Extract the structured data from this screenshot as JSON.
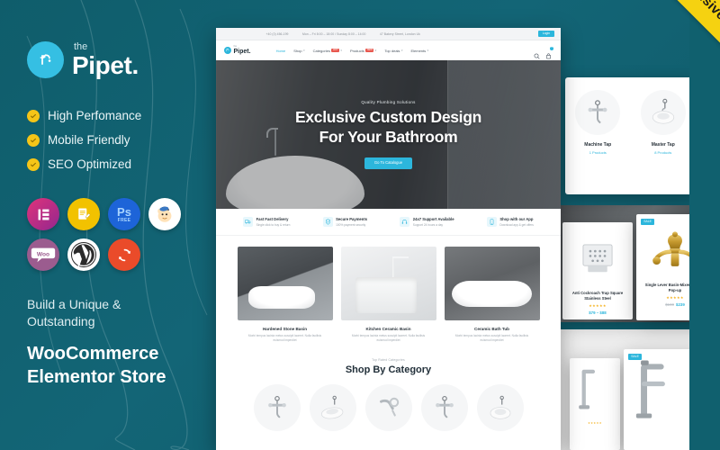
{
  "ribbon": {
    "label": "Responsive"
  },
  "promo": {
    "logo": {
      "the": "the",
      "name": "Pipet.",
      "icon": "faucet-icon"
    },
    "bullets": [
      {
        "label": "High Perfomance",
        "icon": "check-circle-icon"
      },
      {
        "label": "Mobile Friendly",
        "icon": "check-circle-icon"
      },
      {
        "label": "SEO Optimized",
        "icon": "check-circle-icon"
      }
    ],
    "badges": [
      {
        "name": "elementor-badge",
        "label": "Elementor"
      },
      {
        "name": "notes-badge",
        "label": "Documentation"
      },
      {
        "name": "photoshop-badge",
        "label": "Ps",
        "sub": "FREE"
      },
      {
        "name": "mailchimp-badge",
        "label": "Mailchimp"
      },
      {
        "name": "woocommerce-badge",
        "label": "Woo"
      },
      {
        "name": "wordpress-badge",
        "label": "WordPress"
      },
      {
        "name": "updates-badge",
        "label": "Free Updates"
      }
    ],
    "tagline_small": "Build a Unique &\nOutstanding",
    "tagline_big_1": "WooCommerce",
    "tagline_big_2": "Elementor Store"
  },
  "site": {
    "topbar": {
      "phone": "+40 (0) 456-199",
      "hours": "Mon – Fri 8:00 – 18:00 / Sunday 8:00 – 14:00",
      "address": "47 Bakery Street, London Uk",
      "login_label": "Login"
    },
    "nav": {
      "brand_the": "the",
      "brand_name": "Pipet.",
      "links": [
        {
          "label": "Home",
          "active": true,
          "caret": false,
          "pill": ""
        },
        {
          "label": "Shop",
          "active": false,
          "caret": true,
          "pill": ""
        },
        {
          "label": "Categories",
          "active": false,
          "caret": true,
          "pill": "HOT"
        },
        {
          "label": "Products",
          "active": false,
          "caret": true,
          "pill": "NEW"
        },
        {
          "label": "Top deals",
          "active": false,
          "caret": true,
          "pill": ""
        },
        {
          "label": "Elements",
          "active": false,
          "caret": true,
          "pill": ""
        }
      ],
      "search_icon": "search-icon",
      "cart_icon": "cart-icon",
      "cart_count": "0"
    },
    "hero": {
      "kicker": "Quality Plumbing Solutions",
      "title_line1": "Exclusive Custom Design",
      "title_line2": "For Your Bathroom",
      "cta": "Go To Catalogue"
    },
    "features": [
      {
        "title": "Fast Fast Delivery",
        "sub": "Single click to buy & return",
        "icon": "truck-icon"
      },
      {
        "title": "Secure Payments",
        "sub": "100% payment security",
        "icon": "shield-card-icon"
      },
      {
        "title": "24x7 Support Available",
        "sub": "Support 24 hours a day",
        "icon": "headset-icon"
      },
      {
        "title": "Shop with our App",
        "sub": "Download app & get offers",
        "icon": "mobile-app-icon"
      }
    ],
    "products": [
      {
        "title": "Hardened Stone Basin",
        "desc": "Morbi tempus lacinia metus suscipit laoreet. Nulla facilisis euismod imperdiet"
      },
      {
        "title": "Kitchen Ceramic Basin",
        "desc": "Morbi tempus lacinia metus suscipit laoreet. Nulla facilisis euismod imperdiet"
      },
      {
        "title": "Ceramic Bath Tub",
        "desc": "Morbi tempus lacinia metus suscipit laoreet. Nulla facilisis euismod imperdiet"
      }
    ],
    "shop_by_category": {
      "kicker": "Top Rated Categories",
      "heading": "Shop By Category",
      "items": [
        {
          "icon": "wall-mixer-tap-icon"
        },
        {
          "icon": "oval-basin-icon"
        },
        {
          "icon": "wall-spout-mixer-icon"
        },
        {
          "icon": "wall-mixer-tap-icon"
        },
        {
          "icon": "round-basin-icon"
        }
      ]
    }
  },
  "right_panel": {
    "categories": [
      {
        "name": "Machine Tap",
        "count": "1 Products",
        "icon": "machine-tap-icon"
      },
      {
        "name": "Master Tap",
        "count": "8 Products",
        "icon": "master-tap-icon"
      }
    ],
    "products": [
      {
        "title": "Anti Cockroach Trap Square Stainless Steel",
        "stars": "★★★★★",
        "price": "$79 – $88",
        "old_price": "",
        "sale": "",
        "icon": "floor-drain-icon"
      },
      {
        "title": "Single Lever Basin-Mixer Without Pop-up",
        "stars": "★★★★★",
        "price": "$239",
        "old_price": "$190",
        "sale": "SALE",
        "icon": "gold-basin-mixer-icon"
      }
    ],
    "bottom_products": [
      {
        "sale": "",
        "icon": "tall-tap-icon"
      },
      {
        "sale": "SALE",
        "icon": "tall-basin-mixer-icon"
      }
    ]
  },
  "colors": {
    "teal": "#10606e",
    "accent": "#2cb6dc",
    "yellow": "#f5d211",
    "tick": "#f5c518",
    "star": "#f5b220"
  }
}
